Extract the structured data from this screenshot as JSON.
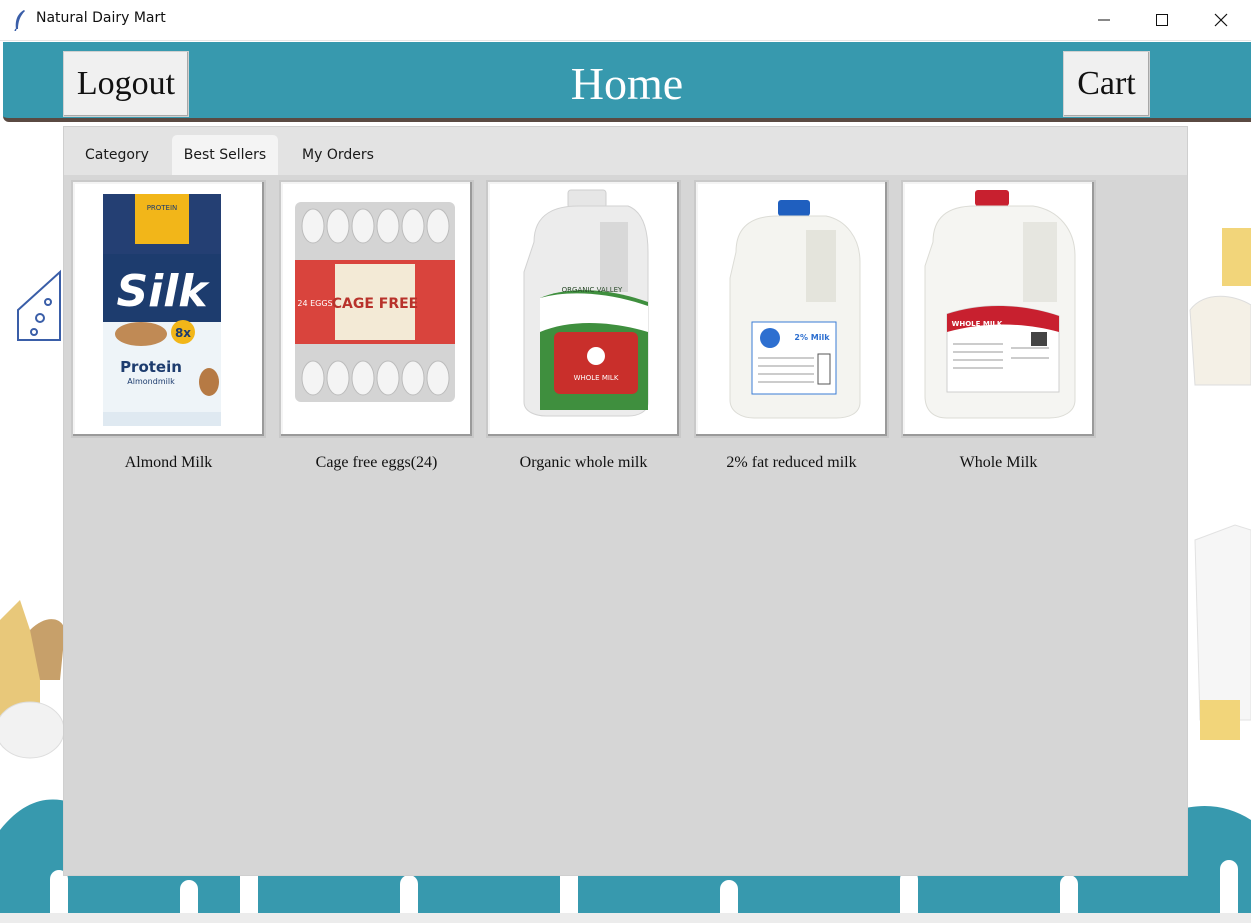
{
  "window": {
    "title": "Natural Dairy Mart"
  },
  "header": {
    "title": "Home",
    "logout_label": "Logout",
    "cart_label": "Cart",
    "color": "#3799ae"
  },
  "tabs": [
    {
      "label": "Category",
      "selected": false
    },
    {
      "label": "Best Sellers",
      "selected": true
    },
    {
      "label": "My Orders",
      "selected": false
    }
  ],
  "products": [
    {
      "name": "Almond Milk",
      "image": "silk-protein-almondmilk-carton"
    },
    {
      "name": "Cage free eggs(24)",
      "image": "cage-free-eggs-carton"
    },
    {
      "name": "Organic whole milk",
      "image": "organic-valley-milk-jug"
    },
    {
      "name": "2% fat reduced milk",
      "image": "great-value-2-percent-milk-jug"
    },
    {
      "name": "Whole Milk",
      "image": "whole-milk-gallon-jug"
    }
  ],
  "product_images": {
    "almond_brand": "Silk",
    "almond_sub": "Protein",
    "almond_sub2": "Almondmilk",
    "almond_badge": "8x",
    "almond_top": "PROTEIN",
    "eggs_label": "CAGE FREE",
    "eggs_count": "24 EGGS",
    "organic_brand": "ORGANIC VALLEY",
    "organic_label": "WHOLE MILK",
    "reduced_label": "2% Milk",
    "whole_label": "WHOLE MILK"
  }
}
